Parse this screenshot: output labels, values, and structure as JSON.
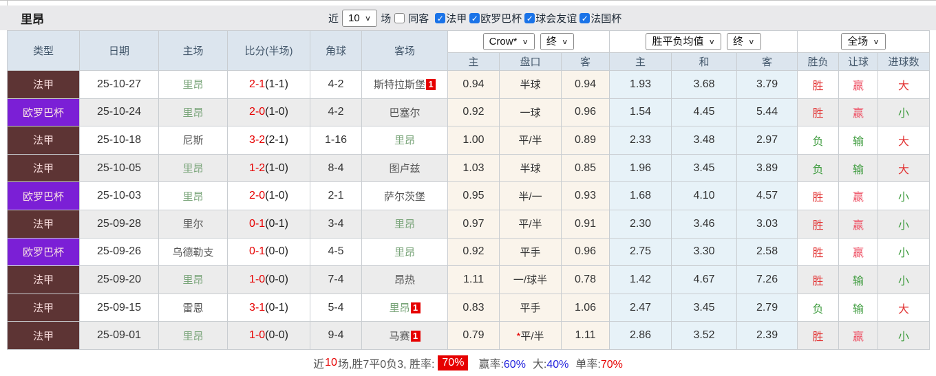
{
  "app": {
    "team": "里昂"
  },
  "icons": {
    "check": "✓",
    "chevron": "∨",
    "badge": "1"
  },
  "colors": {
    "league_bg": {
      "法甲": "#5d3434",
      "欧罗巴杯": "#7b1fd6"
    },
    "league_fg": {
      "法甲": "#f5d8d8",
      "欧罗巴杯": "#fae3e3"
    },
    "win_red": "#e23434",
    "lose_green": "#3f9c3f",
    "rose": "#ee4f63",
    "accent_blue": "#1a73e8",
    "badge_red": "#e60000"
  },
  "toolbar": {
    "recent_label": "近",
    "recent_value": "10",
    "matches_label": "场",
    "same_away_label": "同客",
    "same_away_checked": false,
    "league_filters": [
      {
        "label": "法甲",
        "checked": true
      },
      {
        "label": "欧罗巴杯",
        "checked": true
      },
      {
        "label": "球会友谊",
        "checked": true
      },
      {
        "label": "法国杯",
        "checked": true
      }
    ]
  },
  "table": {
    "columns": [
      "类型",
      "日期",
      "主场",
      "比分(半场)",
      "角球",
      "客场"
    ],
    "selects": {
      "odds_source": "Crow*",
      "odds_time": "终",
      "avg_metric": "胜平负均值",
      "avg_time": "终",
      "scope": "全场"
    },
    "sub_headers": [
      "主",
      "盘口",
      "客",
      "主",
      "和",
      "客",
      "胜负",
      "让球",
      "进球数"
    ],
    "rows": [
      {
        "league": "法甲",
        "date": "25-10-27",
        "home": "里昂",
        "home_badge": "",
        "score": "2-1",
        "half": "(1-1)",
        "corners": "4-2",
        "away": "斯特拉斯堡",
        "away_badge": "1",
        "odds": [
          "0.94",
          "半球",
          "0.94"
        ],
        "avg": [
          "1.93",
          "3.68",
          "3.79"
        ],
        "res": [
          [
            "胜",
            "r"
          ],
          [
            "赢",
            "o"
          ],
          [
            "大",
            "r"
          ]
        ]
      },
      {
        "league": "欧罗巴杯",
        "date": "25-10-24",
        "home": "里昂",
        "home_badge": "",
        "score": "2-0",
        "half": "(1-0)",
        "corners": "4-2",
        "away": "巴塞尔",
        "away_badge": "",
        "odds": [
          "0.92",
          "一球",
          "0.96"
        ],
        "avg": [
          "1.54",
          "4.45",
          "5.44"
        ],
        "res": [
          [
            "胜",
            "r"
          ],
          [
            "赢",
            "o"
          ],
          [
            "小",
            "g"
          ]
        ]
      },
      {
        "league": "法甲",
        "date": "25-10-18",
        "home": "尼斯",
        "home_badge": "",
        "score": "3-2",
        "half": "(2-1)",
        "corners": "1-16",
        "away": "里昂",
        "away_badge": "",
        "odds": [
          "1.00",
          "平/半",
          "0.89"
        ],
        "avg": [
          "2.33",
          "3.48",
          "2.97"
        ],
        "res": [
          [
            "负",
            "g"
          ],
          [
            "输",
            "g"
          ],
          [
            "大",
            "r"
          ]
        ]
      },
      {
        "league": "法甲",
        "date": "25-10-05",
        "home": "里昂",
        "home_badge": "",
        "score": "1-2",
        "half": "(1-0)",
        "corners": "8-4",
        "away": "图卢兹",
        "away_badge": "",
        "odds": [
          "1.03",
          "半球",
          "0.85"
        ],
        "avg": [
          "1.96",
          "3.45",
          "3.89"
        ],
        "res": [
          [
            "负",
            "g"
          ],
          [
            "输",
            "g"
          ],
          [
            "大",
            "r"
          ]
        ]
      },
      {
        "league": "欧罗巴杯",
        "date": "25-10-03",
        "home": "里昂",
        "home_badge": "",
        "score": "2-0",
        "half": "(1-0)",
        "corners": "2-1",
        "away": "萨尔茨堡",
        "away_badge": "",
        "odds": [
          "0.95",
          "半/一",
          "0.93"
        ],
        "avg": [
          "1.68",
          "4.10",
          "4.57"
        ],
        "res": [
          [
            "胜",
            "r"
          ],
          [
            "赢",
            "o"
          ],
          [
            "小",
            "g"
          ]
        ]
      },
      {
        "league": "法甲",
        "date": "25-09-28",
        "home": "里尔",
        "home_badge": "",
        "score": "0-1",
        "half": "(0-1)",
        "corners": "3-4",
        "away": "里昂",
        "away_badge": "",
        "odds": [
          "0.97",
          "平/半",
          "0.91"
        ],
        "avg": [
          "2.30",
          "3.46",
          "3.03"
        ],
        "res": [
          [
            "胜",
            "r"
          ],
          [
            "赢",
            "o"
          ],
          [
            "小",
            "g"
          ]
        ]
      },
      {
        "league": "欧罗巴杯",
        "date": "25-09-26",
        "home": "乌德勒支",
        "home_badge": "",
        "score": "0-1",
        "half": "(0-0)",
        "corners": "4-5",
        "away": "里昂",
        "away_badge": "",
        "odds": [
          "0.92",
          "平手",
          "0.96"
        ],
        "avg": [
          "2.75",
          "3.30",
          "2.58"
        ],
        "res": [
          [
            "胜",
            "r"
          ],
          [
            "赢",
            "o"
          ],
          [
            "小",
            "g"
          ]
        ]
      },
      {
        "league": "法甲",
        "date": "25-09-20",
        "home": "里昂",
        "home_badge": "",
        "score": "1-0",
        "half": "(0-0)",
        "corners": "7-4",
        "away": "昂热",
        "away_badge": "",
        "odds": [
          "1.11",
          "一/球半",
          "0.78"
        ],
        "avg": [
          "1.42",
          "4.67",
          "7.26"
        ],
        "res": [
          [
            "胜",
            "r"
          ],
          [
            "输",
            "g"
          ],
          [
            "小",
            "g"
          ]
        ]
      },
      {
        "league": "法甲",
        "date": "25-09-15",
        "home": "雷恩",
        "home_badge": "",
        "score": "3-1",
        "half": "(0-1)",
        "corners": "5-4",
        "away": "里昂",
        "away_badge": "1",
        "odds": [
          "0.83",
          "平手",
          "1.06"
        ],
        "avg": [
          "2.47",
          "3.45",
          "2.79"
        ],
        "res": [
          [
            "负",
            "g"
          ],
          [
            "输",
            "g"
          ],
          [
            "大",
            "r"
          ]
        ]
      },
      {
        "league": "法甲",
        "date": "25-09-01",
        "home": "里昂",
        "home_badge": "",
        "score": "1-0",
        "half": "(0-0)",
        "corners": "9-4",
        "away": "马赛",
        "away_badge": "1",
        "odds": [
          "0.79",
          "*平/半",
          "1.11"
        ],
        "avg": [
          "2.86",
          "3.52",
          "2.39"
        ],
        "res": [
          [
            "胜",
            "r"
          ],
          [
            "赢",
            "o"
          ],
          [
            "小",
            "g"
          ]
        ]
      }
    ]
  },
  "footer": {
    "prefix": "近",
    "count": "10",
    "mid": "场,胜7平0负3, 胜率:",
    "win_rate": "70%",
    "segments": [
      {
        "label": "赢率:",
        "value": "60%",
        "color": "blue"
      },
      {
        "label": "大:",
        "value": "40%",
        "color": "blue"
      },
      {
        "label": "单率:",
        "value": "70%",
        "color": "red"
      }
    ]
  }
}
